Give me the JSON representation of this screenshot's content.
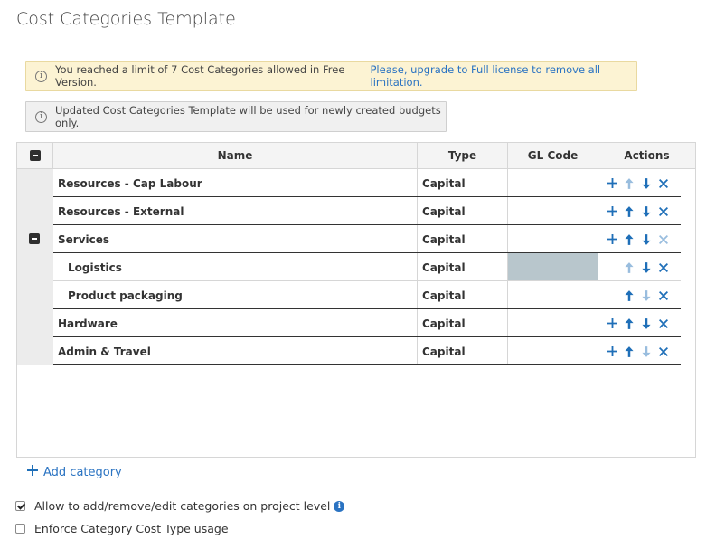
{
  "page": {
    "title": "Cost Categories Template"
  },
  "alerts": {
    "limit_text": "You reached a limit of 7 Cost Categories allowed in Free Version.",
    "limit_link": "Please, upgrade to Full license to remove all limitation.",
    "info_text": "Updated Cost Categories Template will be used for newly created budgets only."
  },
  "grid": {
    "headers": {
      "name": "Name",
      "type": "Type",
      "gl": "GL Code",
      "actions": "Actions"
    },
    "rows": [
      {
        "name": "Resources - Cap Labour",
        "type": "Capital"
      },
      {
        "name": "Resources - External",
        "type": "Capital"
      },
      {
        "name": "Services",
        "type": "Capital"
      },
      {
        "name": "Logistics",
        "type": "Capital"
      },
      {
        "name": "Product packaging",
        "type": "Capital"
      },
      {
        "name": "Hardware",
        "type": "Capital"
      },
      {
        "name": "Admin & Travel",
        "type": "Capital"
      }
    ]
  },
  "footer": {
    "add_category": "Add category",
    "allow_edit_label": "Allow to add/remove/edit categories on project level",
    "allow_edit_checked": true,
    "enforce_label": "Enforce Category Cost Type usage",
    "enforce_checked": false
  },
  "icons": [
    "info-icon",
    "collapse-icon",
    "add-icon",
    "arrow-up-icon",
    "arrow-down-icon",
    "delete-icon"
  ],
  "colors": {
    "accent": "#2a73c2",
    "warning_bg": "#fcf3d3",
    "selected_cell": "#b8c6cc"
  }
}
